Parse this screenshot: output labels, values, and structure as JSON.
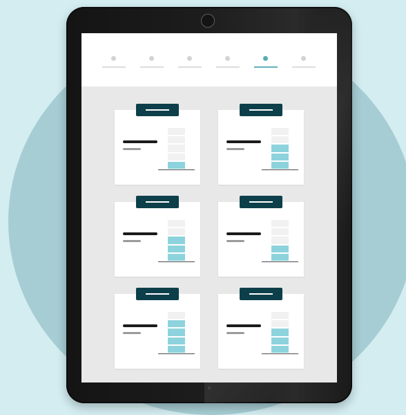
{
  "colors": {
    "background": "#d3edf1",
    "circle": "#a6cdd4",
    "tablet_frame": "#1a1a1a",
    "screen": "#e8e8e8",
    "card": "#ffffff",
    "tag": "#0c3f4a",
    "gauge_fill": "#8dd3dd",
    "gauge_empty": "#f1f1f1",
    "step_inactive": "#d3d3d3",
    "step_active": "#55aeb4"
  },
  "stepper": {
    "total_steps": 6,
    "active_step": 5
  },
  "gauge_segments": 5,
  "cards": [
    {
      "id": "card-1",
      "filled_segments": 1
    },
    {
      "id": "card-2",
      "filled_segments": 3
    },
    {
      "id": "card-3",
      "filled_segments": 3
    },
    {
      "id": "card-4",
      "filled_segments": 2
    },
    {
      "id": "card-5",
      "filled_segments": 4
    },
    {
      "id": "card-6",
      "filled_segments": 3
    }
  ]
}
